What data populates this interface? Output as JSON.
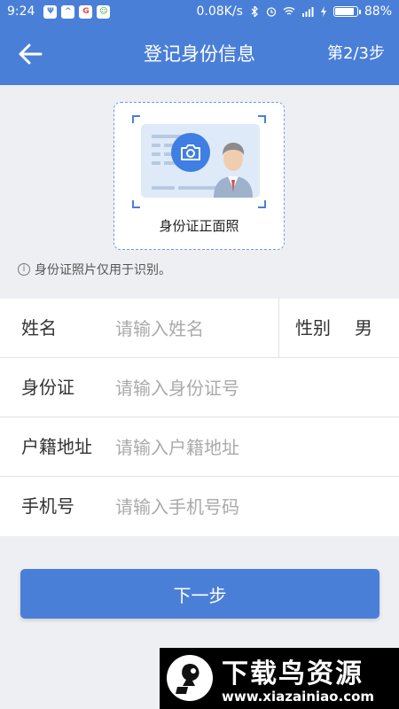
{
  "status_bar": {
    "time": "9:24",
    "network_speed": "0.08K/s",
    "battery_percent": "88%",
    "battery_level": 0.88,
    "app_icons": [
      "Ψ",
      "^",
      "G",
      "☺"
    ]
  },
  "header": {
    "title": "登记身份信息",
    "step": "第2/3步"
  },
  "photo": {
    "label": "身份证正面照"
  },
  "hint": {
    "icon": "i",
    "text": "身份证照片仅用于识别。"
  },
  "form": {
    "name": {
      "label": "姓名",
      "placeholder": "请输入姓名"
    },
    "gender": {
      "label": "性别",
      "value": "男"
    },
    "id_number": {
      "label": "身份证",
      "placeholder": "请输入身份证号"
    },
    "address": {
      "label": "户籍地址",
      "placeholder": "请输入户籍地址"
    },
    "phone": {
      "label": "手机号",
      "placeholder": "请输入手机号码"
    }
  },
  "next_button": {
    "label": "下一步"
  },
  "watermark": {
    "title": "下载鸟资源",
    "url": "www.xiazainiao.com"
  },
  "colors": {
    "primary": "#4a7fd8",
    "background": "#eeeff3"
  }
}
